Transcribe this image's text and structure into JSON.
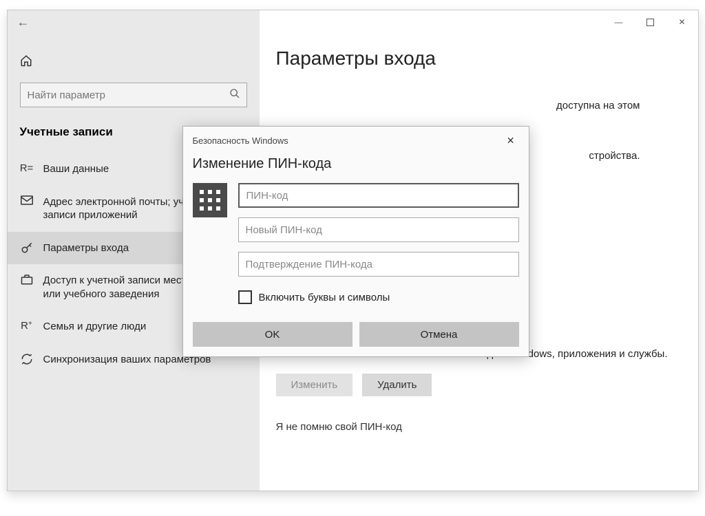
{
  "sidebar": {
    "search_placeholder": "Найти параметр",
    "section_title": "Учетные записи",
    "items": [
      {
        "label": "Ваши данные"
      },
      {
        "label": "Адрес электронной почты; учетные записи приложений"
      },
      {
        "label": "Параметры входа"
      },
      {
        "label": "Доступ к учетной записи места работы или учебного заведения"
      },
      {
        "label": "Семья и другие люди"
      },
      {
        "label": "Синхронизация ваших параметров"
      }
    ]
  },
  "main": {
    "page_title": "Параметры входа",
    "text_hello_avail": "доступна на этом",
    "text_device": "стройства.",
    "text_pin_desc": "да в Windows, приложения и службы.",
    "btn_change": "Изменить",
    "btn_delete": "Удалить",
    "forgot_link": "Я не помню свой ПИН-код"
  },
  "dialog": {
    "head": "Безопасность Windows",
    "title": "Изменение ПИН-кода",
    "pin_current_ph": "ПИН-код",
    "pin_new_ph": "Новый ПИН-код",
    "pin_confirm_ph": "Подтверждение ПИН-кода",
    "checkbox_label": "Включить буквы и символы",
    "ok": "OK",
    "cancel": "Отмена"
  }
}
